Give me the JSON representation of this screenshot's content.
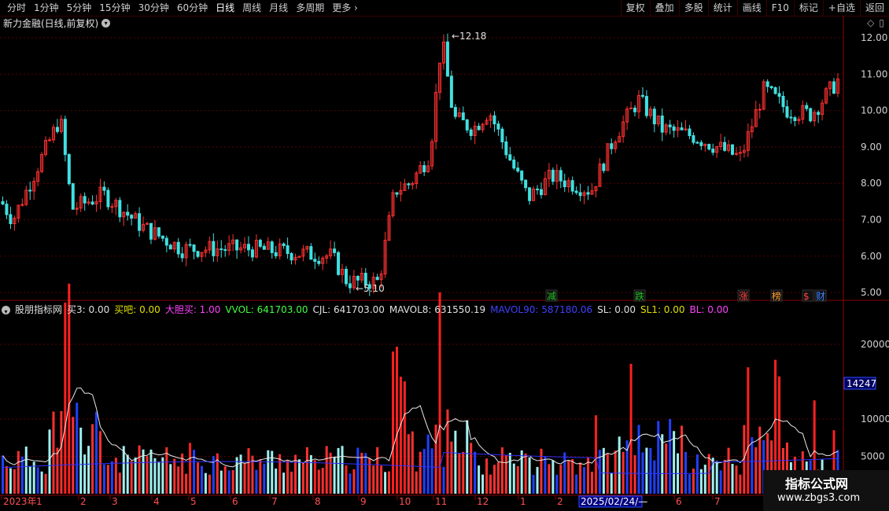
{
  "toolbar": {
    "periods": [
      "分时",
      "1分钟",
      "5分钟",
      "15分钟",
      "30分钟",
      "60分钟",
      "日线",
      "周线",
      "月线",
      "多周期",
      "更多"
    ],
    "active_period": "日线",
    "right_buttons": [
      "复权",
      "叠加",
      "多股",
      "统计",
      "画线",
      "F10",
      "标记",
      "+自选",
      "返回"
    ]
  },
  "chart_title": "新力金融(日线,前复权)",
  "price_axis": [
    "12.00",
    "11.00",
    "10.00",
    "9.00",
    "8.00",
    "7.00",
    "6.00",
    "5.00"
  ],
  "price_high_label": "12.18",
  "price_low_label": "5.10",
  "event_markers": [
    {
      "label": "减",
      "color": "#20c020"
    },
    {
      "label": "跌",
      "color": "#20c020"
    },
    {
      "label": "涨",
      "color": "#ff4040"
    },
    {
      "label": "榜",
      "color": "#ffa030"
    },
    {
      "label": "$",
      "color": "#ff4040"
    },
    {
      "label": "财",
      "color": "#4080ff"
    }
  ],
  "indicator": {
    "name": "股朋指标网",
    "fields": [
      {
        "label": "买3: 0.00",
        "color": "#e0e0e0"
      },
      {
        "label": "买吧: 0.00",
        "color": "#e0e000"
      },
      {
        "label": "大胆买: 1.00",
        "color": "#ff40ff"
      },
      {
        "label": "VVOL: 641703.00",
        "color": "#40ff40"
      },
      {
        "label": "CJL: 641703.00",
        "color": "#e0e0e0"
      },
      {
        "label": "MAVOL8: 631550.19",
        "color": "#e0e0e0"
      },
      {
        "label": "MAVOL90: 587180.06",
        "color": "#4040ff"
      },
      {
        "label": "SL: 0.00",
        "color": "#e0e0e0"
      },
      {
        "label": "SL1: 0.00",
        "color": "#e0e000"
      },
      {
        "label": "BL: 0.00",
        "color": "#ff40ff"
      }
    ]
  },
  "volume_axis": [
    "20000",
    "10000",
    "5000"
  ],
  "volume_highlight": "14247",
  "time_axis": [
    "2023年",
    "1",
    "2",
    "3",
    "4",
    "5",
    "6",
    "7",
    "8",
    "9",
    "10",
    "11",
    "12",
    "1",
    "2",
    "5",
    "6",
    "7"
  ],
  "cursor_date": "2025/02/24/—",
  "logo": {
    "name": "指标公式网",
    "url": "www.zbgs3.com"
  },
  "colors": {
    "up": "#ff3030",
    "down": "#40e0e0",
    "grid": "#5a0000",
    "axis": "#8b0000",
    "ma90": "#3030ff"
  }
}
